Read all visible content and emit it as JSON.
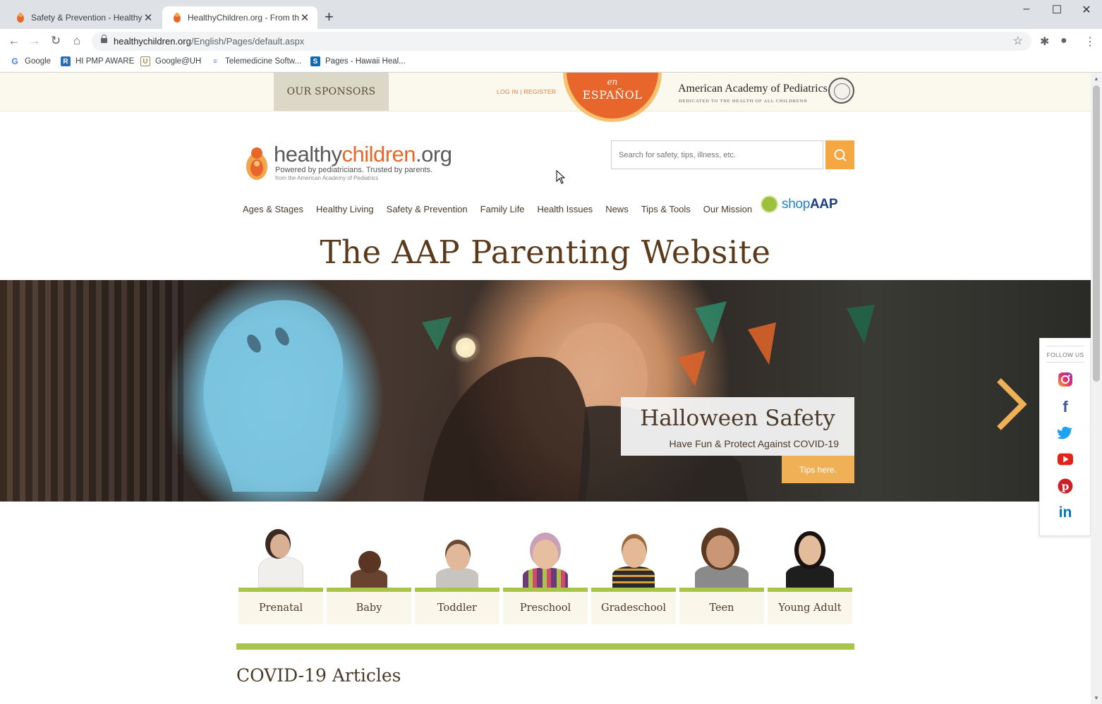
{
  "browser": {
    "tabs": [
      {
        "title": "Safety & Prevention - HealthyCh",
        "active": false
      },
      {
        "title": "HealthyChildren.org - From the A",
        "active": true
      }
    ],
    "url_host": "healthychildren.org",
    "url_path": "/English/Pages/default.aspx",
    "bookmarks": [
      {
        "label": "Google",
        "icon": "google-icon"
      },
      {
        "label": "HI PMP AWARE",
        "icon": "rx-icon"
      },
      {
        "label": "Google@UH",
        "icon": "uh-icon"
      },
      {
        "label": "Telemedicine Softw...",
        "icon": "telemedicine-icon"
      },
      {
        "label": "Pages - Hawaii Heal...",
        "icon": "sharepoint-icon"
      }
    ]
  },
  "topbar": {
    "sponsors_label": "OUR SPONSORS",
    "login_label": "LOG IN | REGISTER",
    "espanol_en": "en",
    "espanol_label": "ESPAÑOL",
    "aap_name": "American Academy of Pediatrics",
    "aap_tagline": "DEDICATED TO THE HEALTH OF ALL CHILDREN®"
  },
  "logo": {
    "healthy": "healthy",
    "children": "children",
    "org": ".org",
    "tagline": "Powered by pediatricians. Trusted by parents.",
    "subtagline": "from the American Academy of Pediatrics"
  },
  "search": {
    "placeholder": "Search for safety, tips, illness, etc."
  },
  "nav": {
    "items": [
      "Ages & Stages",
      "Healthy Living",
      "Safety & Prevention",
      "Family Life",
      "Health Issues",
      "News",
      "Tips & Tools",
      "Our Mission"
    ],
    "shop_prefix": "shop",
    "shop_suffix": "AAP"
  },
  "page_title": "The AAP Parenting Website",
  "hero": {
    "title": "Halloween Safety",
    "subtitle": "Have Fun & Protect Against COVID-19",
    "cta": "Tips here."
  },
  "follow": {
    "label": "FOLLOW US",
    "networks": [
      "instagram",
      "facebook",
      "twitter",
      "youtube",
      "pinterest",
      "linkedin"
    ]
  },
  "ages": [
    "Prenatal",
    "Baby",
    "Toddler",
    "Preschool",
    "Gradeschool",
    "Teen",
    "Young Adult"
  ],
  "section_title": "COVID-19 Articles",
  "colors": {
    "accent_orange": "#e8652b",
    "search_orange": "#f5a742",
    "age_green": "#a9c44a",
    "title_brown": "#5a3a1a"
  }
}
